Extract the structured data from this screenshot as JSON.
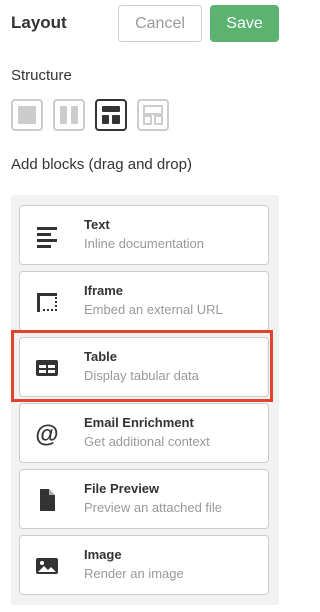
{
  "header": {
    "title": "Layout",
    "cancel_label": "Cancel",
    "save_label": "Save"
  },
  "structure": {
    "label": "Structure",
    "options": [
      {
        "icon": "layout-single-icon",
        "active": false
      },
      {
        "icon": "layout-two-column-icon",
        "active": false
      },
      {
        "icon": "layout-header-two-column-icon",
        "active": true
      },
      {
        "icon": "layout-two-row-icon",
        "active": false
      }
    ]
  },
  "blocks": {
    "label": "Add blocks (drag and drop)",
    "items": [
      {
        "name": "Text",
        "description": "Inline documentation",
        "icon": "text-lines-icon"
      },
      {
        "name": "Iframe",
        "description": "Embed an external URL",
        "icon": "iframe-icon"
      },
      {
        "name": "Table",
        "description": "Display tabular data",
        "icon": "table-icon",
        "selected": true
      },
      {
        "name": "Email Enrichment",
        "description": "Get additional context",
        "icon": "at-sign-icon"
      },
      {
        "name": "File Preview",
        "description": "Preview an attached file",
        "icon": "file-icon"
      },
      {
        "name": "Image",
        "description": "Render an image",
        "icon": "image-icon"
      }
    ]
  },
  "colors": {
    "save": "#5cb270",
    "highlight": "#e0452b",
    "panel": "#f2f2f2"
  }
}
